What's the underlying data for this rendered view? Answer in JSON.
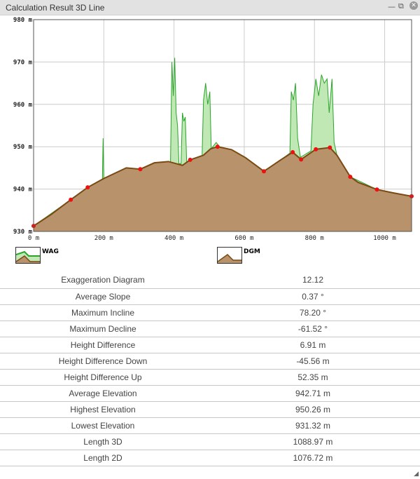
{
  "window": {
    "title": "Calculation Result 3D Line",
    "minimize_icon": "minimize-icon",
    "restore_icon": "restore-icon",
    "close_icon": "close-icon"
  },
  "chart_data": {
    "type": "area",
    "title": "",
    "xlabel": "",
    "ylabel": "",
    "xlim": [
      0,
      1076.72
    ],
    "ylim": [
      930,
      980
    ],
    "x_ticks": [
      0,
      200,
      400,
      600,
      800,
      1000
    ],
    "x_tick_labels": [
      "0 m",
      "200 m",
      "400 m",
      "600 m",
      "800 m",
      "1000 m"
    ],
    "y_ticks": [
      930,
      940,
      950,
      960,
      970,
      980
    ],
    "y_tick_labels": [
      "930 m",
      "940 m",
      "950 m",
      "960 m",
      "970 m",
      "980 m"
    ],
    "grid": true,
    "colors": {
      "terrain_fill": "#b8926b",
      "terrain_line": "#7a4a12",
      "wag_line": "#2aa52a",
      "wag_fill": "#bfe8b5",
      "marker": "#ee1111"
    },
    "series": [
      {
        "name": "DGM",
        "points": [
          [
            0,
            931.3
          ],
          [
            50,
            934
          ],
          [
            106,
            937.5
          ],
          [
            154,
            940.4
          ],
          [
            200,
            942.5
          ],
          [
            264,
            945
          ],
          [
            304,
            944.7
          ],
          [
            344,
            946.2
          ],
          [
            384,
            946.5
          ],
          [
            424,
            945.6
          ],
          [
            446,
            946.9
          ],
          [
            484,
            948
          ],
          [
            504,
            949.5
          ],
          [
            524,
            950
          ],
          [
            564,
            949.3
          ],
          [
            604,
            947.4
          ],
          [
            656,
            944.2
          ],
          [
            704,
            946.9
          ],
          [
            738,
            948.7
          ],
          [
            762,
            947
          ],
          [
            804,
            949.4
          ],
          [
            844,
            949.8
          ],
          [
            864,
            948
          ],
          [
            902,
            942.9
          ],
          [
            924,
            941.6
          ],
          [
            978,
            939.9
          ],
          [
            1024,
            939.1
          ],
          [
            1076.7,
            938.3
          ]
        ]
      },
      {
        "name": "WAG",
        "points": [
          [
            0,
            931.3
          ],
          [
            106,
            937.5
          ],
          [
            154,
            940.4
          ],
          [
            196,
            942.3
          ],
          [
            198,
            952
          ],
          [
            200,
            942.5
          ],
          [
            264,
            945
          ],
          [
            304,
            944.7
          ],
          [
            344,
            946.2
          ],
          [
            390,
            946.3
          ],
          [
            394,
            970
          ],
          [
            398,
            962
          ],
          [
            402,
            971
          ],
          [
            406,
            958
          ],
          [
            410,
            955
          ],
          [
            414,
            946
          ],
          [
            420,
            946
          ],
          [
            424,
            958
          ],
          [
            428,
            956
          ],
          [
            432,
            957
          ],
          [
            436,
            946.5
          ],
          [
            480,
            947.8
          ],
          [
            484,
            961
          ],
          [
            490,
            965
          ],
          [
            496,
            960
          ],
          [
            502,
            963
          ],
          [
            506,
            949.5
          ],
          [
            520,
            951
          ],
          [
            530,
            950
          ],
          [
            564,
            949.3
          ],
          [
            604,
            947.4
          ],
          [
            656,
            944.2
          ],
          [
            704,
            946.9
          ],
          [
            730,
            948.5
          ],
          [
            734,
            963
          ],
          [
            740,
            961
          ],
          [
            746,
            965
          ],
          [
            752,
            952
          ],
          [
            760,
            947.5
          ],
          [
            790,
            949
          ],
          [
            796,
            960
          ],
          [
            804,
            966
          ],
          [
            812,
            962
          ],
          [
            820,
            967
          ],
          [
            828,
            965
          ],
          [
            836,
            966
          ],
          [
            842,
            958
          ],
          [
            850,
            966
          ],
          [
            856,
            951
          ],
          [
            864,
            948
          ],
          [
            902,
            942.9
          ],
          [
            978,
            939.9
          ],
          [
            1076.7,
            938.3
          ]
        ]
      }
    ],
    "markers": [
      [
        0,
        931.3
      ],
      [
        106,
        937.5
      ],
      [
        154,
        940.4
      ],
      [
        304,
        944.7
      ],
      [
        446,
        946.9
      ],
      [
        524,
        950
      ],
      [
        656,
        944.2
      ],
      [
        738,
        948.7
      ],
      [
        762,
        947
      ],
      [
        804,
        949.4
      ],
      [
        844,
        949.8
      ],
      [
        902,
        942.9
      ],
      [
        978,
        939.9
      ],
      [
        1076.7,
        938.3
      ]
    ],
    "legend": [
      "WAG",
      "DGM"
    ],
    "legend_position": "bottom"
  },
  "stats": [
    {
      "label": "Exaggeration Diagram",
      "value": "12.12"
    },
    {
      "label": "Average Slope",
      "value": "0.37 °"
    },
    {
      "label": "Maximum Incline",
      "value": "78.20 °"
    },
    {
      "label": "Maximum Decline",
      "value": "-61.52 °"
    },
    {
      "label": "Height Difference",
      "value": "6.91 m"
    },
    {
      "label": "Height Difference Down",
      "value": "-45.56 m"
    },
    {
      "label": "Height Difference Up",
      "value": "52.35 m"
    },
    {
      "label": "Average Elevation",
      "value": "942.71 m"
    },
    {
      "label": "Highest Elevation",
      "value": "950.26 m"
    },
    {
      "label": "Lowest Elevation",
      "value": "931.32 m"
    },
    {
      "label": "Length 3D",
      "value": "1088.97 m"
    },
    {
      "label": "Length 2D",
      "value": "1076.72 m"
    }
  ]
}
